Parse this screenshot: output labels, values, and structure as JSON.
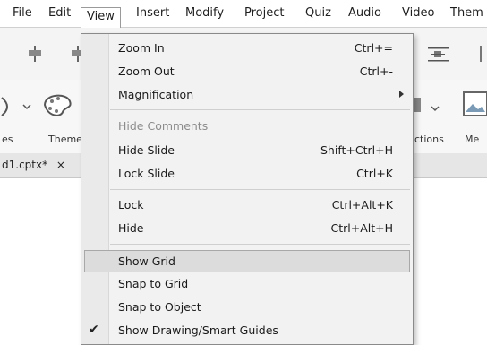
{
  "menubar": {
    "items": [
      {
        "label": "File"
      },
      {
        "label": "Edit"
      },
      {
        "label": "View"
      },
      {
        "label": "Insert"
      },
      {
        "label": "Modify"
      },
      {
        "label": "Project"
      },
      {
        "label": "Quiz"
      },
      {
        "label": "Audio"
      },
      {
        "label": "Video"
      },
      {
        "label": "Them"
      }
    ]
  },
  "ribbon": {
    "left_label": "es",
    "themes_label": "Theme",
    "interactions_label": "ctions",
    "media_label": "Me"
  },
  "doc_tab": {
    "label": "d1.cptx*",
    "close": "×"
  },
  "dropdown": {
    "zoom_in": {
      "label": "Zoom In",
      "shortcut": "Ctrl+="
    },
    "zoom_out": {
      "label": "Zoom Out",
      "shortcut": "Ctrl+-"
    },
    "magnification": {
      "label": "Magnification"
    },
    "hide_comments": {
      "label": "Hide Comments"
    },
    "hide_slide": {
      "label": "Hide Slide",
      "shortcut": "Shift+Ctrl+H"
    },
    "lock_slide": {
      "label": "Lock Slide",
      "shortcut": "Ctrl+K"
    },
    "lock": {
      "label": "Lock",
      "shortcut": "Ctrl+Alt+K"
    },
    "hide": {
      "label": "Hide",
      "shortcut": "Ctrl+Alt+H"
    },
    "show_grid": {
      "label": "Show Grid"
    },
    "snap_to_grid": {
      "label": "Snap to Grid"
    },
    "snap_to_object": {
      "label": "Snap to Object"
    },
    "show_guides": {
      "label": "Show Drawing/Smart Guides",
      "checked": true,
      "check_glyph": "✔"
    }
  },
  "colors": {
    "menu_bg": "#f2f2f2",
    "highlight": "#dcdcdc",
    "disabled": "#8c8c8c"
  }
}
